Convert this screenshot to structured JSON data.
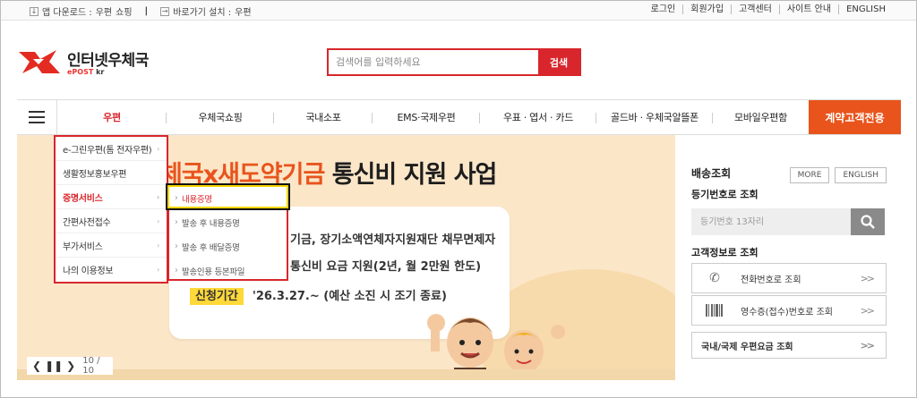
{
  "topbar": {
    "app_download_label": "앱 다운로드 :",
    "app_download_links": [
      "우편",
      "쇼핑"
    ],
    "shortcut_label": "바로가기 설치 :",
    "shortcut_link": "우편",
    "right_links": [
      "로그인",
      "회원가입",
      "고객센터",
      "사이트 안내",
      "ENGLISH"
    ]
  },
  "logo": {
    "name": "인터넷우체국",
    "sub_prefix": "ePOST",
    "sub_suffix": " kr"
  },
  "search": {
    "placeholder": "검색어를 입력하세요",
    "button_label": "검색"
  },
  "nav": {
    "items": [
      "우편",
      "우체국쇼핑",
      "국내소포",
      "EMS·국제우편",
      "우표 · 엽서 · 카드",
      "골드바 · 우체국알뜰폰",
      "모바일우편함"
    ],
    "active_index": 0,
    "cta": "계약고객전용"
  },
  "menu": {
    "level1": [
      "e-그린우편(톰 전자우편)",
      "생활정보홍보우편",
      "증명서비스",
      "간편사전접수",
      "부가서비스",
      "나의 이용정보"
    ],
    "level1_selected": 2,
    "level2": [
      "내용증명",
      "발송 후 내용증명",
      "발송 후 배달증명",
      "발송인용 등본파일"
    ],
    "level2_selected": 0
  },
  "banner": {
    "title_hl": "체국x새도약기금",
    "title_rest": " 통신비 지원 사업",
    "line1": "기금, 장기소액연체자지원재단 채무면제자",
    "line2": "통신비 요금 지원(2년, 월 2만원 한도)",
    "period_label": "신청기간",
    "period_text": "'26.3.27.~ (예산 소진 시 조기 종료)",
    "pager": "10 / 10"
  },
  "tracking": {
    "title": "배송조회",
    "more": "MORE",
    "english": "ENGLISH",
    "by_number": "등기번호로 조회",
    "placeholder": "등기번호 13자리",
    "by_customer": "고객정보로 조회",
    "phone_lookup": "전화번호로 조회",
    "receipt_lookup": "영수증(접수)번호로 조회",
    "rate_lookup": "국내/국제 우편요금 조회"
  },
  "colors": {
    "brand_red": "#d8262c",
    "cta_orange": "#e8541c",
    "banner_bg": "#fbe6c8"
  }
}
